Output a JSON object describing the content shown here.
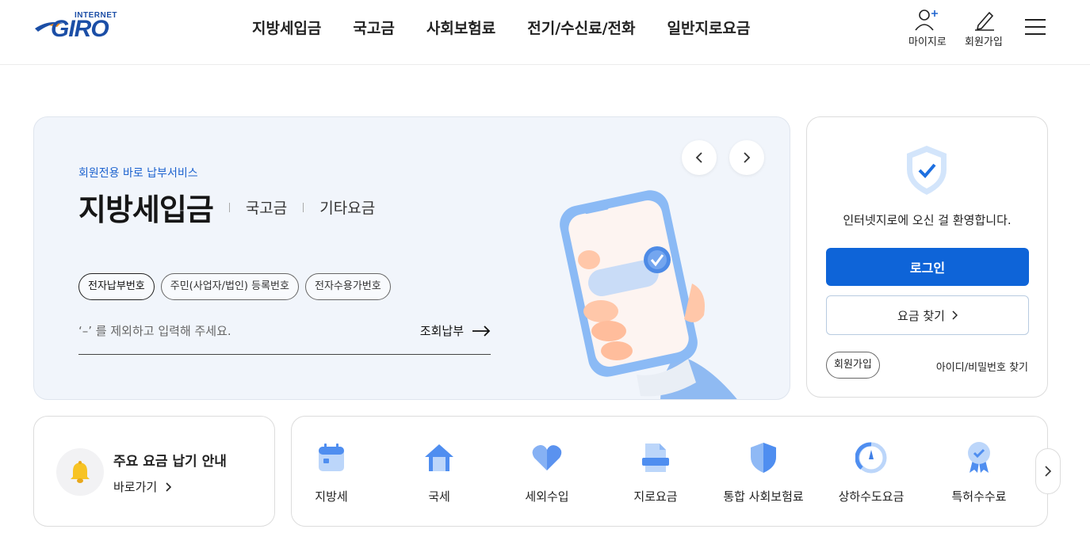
{
  "header": {
    "logo_small": "INTERNET",
    "logo_big": "GIRO",
    "nav": [
      "지방세입금",
      "국고금",
      "사회보험료",
      "전기/수신료/전화",
      "일반지로요금"
    ],
    "my_giro": "마이지로",
    "join": "회원가입"
  },
  "hero": {
    "subtitle": "회원전용 바로 납부서비스",
    "title": "지방세입금",
    "tabs": [
      "국고금",
      "기타요금"
    ],
    "chips": [
      "전자납부번호",
      "주민(사업자/법인) 등록번호",
      "전자수용가번호"
    ],
    "input_placeholder": "‘–’ 를 제외하고 입력해 주세요.",
    "lookup_label": "조회납부"
  },
  "login": {
    "welcome": "인터넷지로에 오신 걸 환영합니다.",
    "login_label": "로그인",
    "find_fee_label": "요금 찾기",
    "join_label": "회원가입",
    "find_id_label": "아이디/비밀번호 찾기"
  },
  "notice": {
    "title": "주요 요금 납기 안내",
    "go_label": "바로가기"
  },
  "categories": [
    "지방세",
    "국세",
    "세외수입",
    "지로요금",
    "통합 사회보험료",
    "상하수도요금",
    "특허수수료"
  ],
  "colors": {
    "primary": "#0e64d8",
    "brand": "#1b4ea6",
    "hero_bg": "#f1f5fb",
    "subtitle": "#1d63cf"
  }
}
